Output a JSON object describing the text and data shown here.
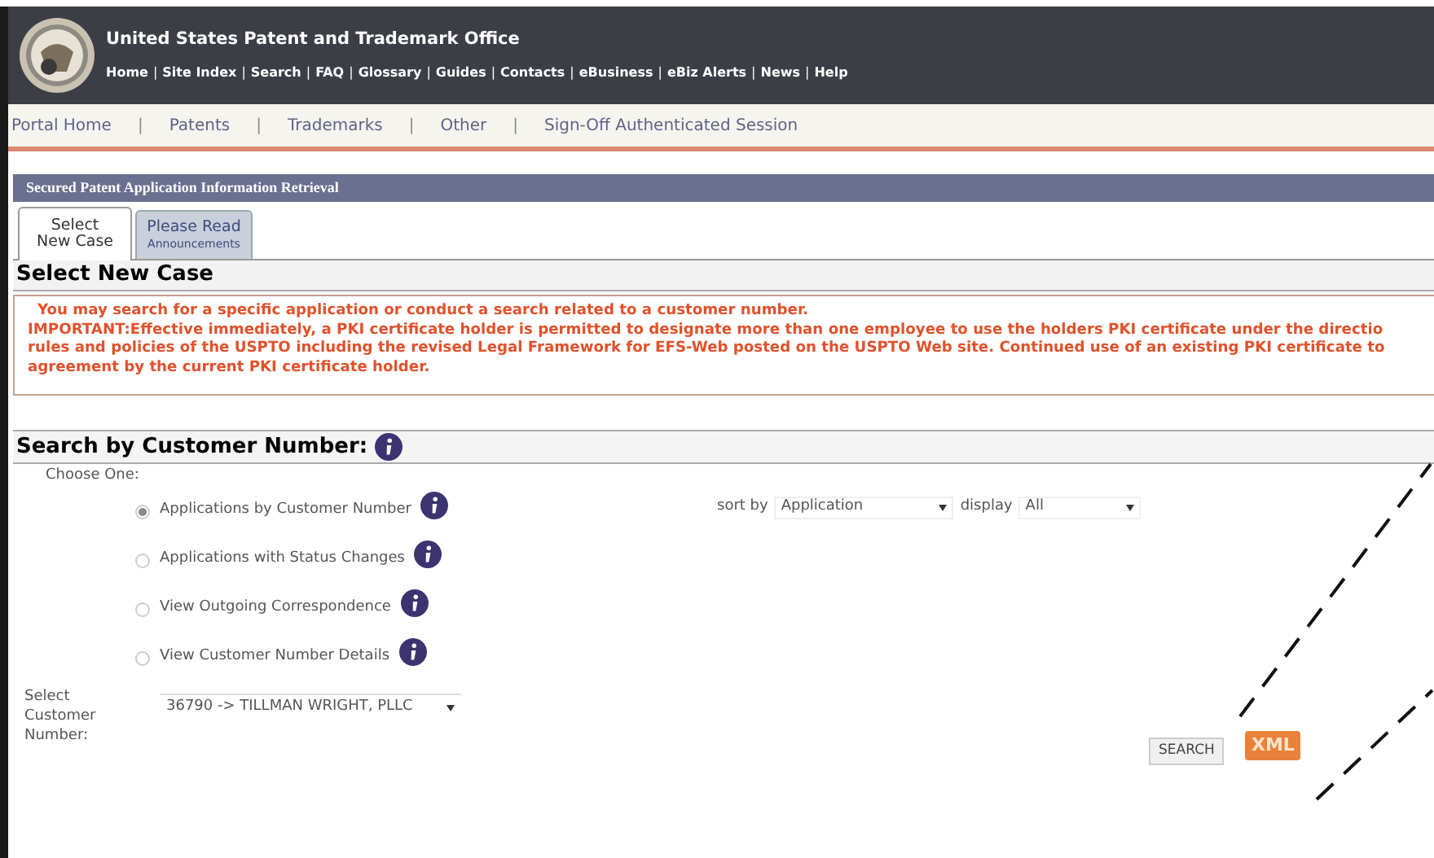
{
  "header": {
    "title": "United States Patent and Trademark Office",
    "links": [
      {
        "kind": "link",
        "text": "Home"
      },
      {
        "kind": "sep",
        "text": "|"
      },
      {
        "kind": "link",
        "text": "Site Index"
      },
      {
        "kind": "sep",
        "text": "|"
      },
      {
        "kind": "link",
        "text": "Search"
      },
      {
        "kind": "sep",
        "text": "|"
      },
      {
        "kind": "link",
        "text": "FAQ"
      },
      {
        "kind": "sep",
        "text": "|"
      },
      {
        "kind": "link",
        "text": "Glossary"
      },
      {
        "kind": "sep",
        "text": "|"
      },
      {
        "kind": "link",
        "text": "Guides"
      },
      {
        "kind": "sep",
        "text": "|"
      },
      {
        "kind": "link",
        "text": "Contacts"
      },
      {
        "kind": "sep",
        "text": "|"
      },
      {
        "kind": "link",
        "text": "eBusiness"
      },
      {
        "kind": "sep",
        "text": "|"
      },
      {
        "kind": "link",
        "text": "eBiz Alerts"
      },
      {
        "kind": "sep",
        "text": "|"
      },
      {
        "kind": "link",
        "text": "News"
      },
      {
        "kind": "sep",
        "text": "|"
      },
      {
        "kind": "link",
        "text": "Help"
      }
    ]
  },
  "nav": [
    {
      "kind": "link",
      "text": "Portal Home"
    },
    {
      "kind": "sep",
      "text": "|"
    },
    {
      "kind": "link",
      "text": "Patents"
    },
    {
      "kind": "sep",
      "text": "|"
    },
    {
      "kind": "link",
      "text": "Trademarks"
    },
    {
      "kind": "sep",
      "text": "|"
    },
    {
      "kind": "link",
      "text": "Other"
    },
    {
      "kind": "sep",
      "text": "|"
    },
    {
      "kind": "link",
      "text": "Sign-Off Authenticated Session"
    }
  ],
  "panel_title": "Secured Patent Application Information Retrieval",
  "tabs": [
    {
      "lines": [
        "Select",
        "New Case"
      ],
      "selected": true
    },
    {
      "lines": [
        "Please Read",
        "Announcements"
      ],
      "selected": false
    }
  ],
  "section_title": "Select New Case",
  "notice": {
    "intro": "You may search for a specific application or conduct a search related to a customer number.",
    "lines": [
      "IMPORTANT:Effective immediately, a PKI certificate holder is permitted to designate more than one employee to use the holders PKI certificate under the directio",
      "rules and policies of the USPTO including the revised Legal Framework for EFS-Web posted on the USPTO Web site. Continued use of an existing PKI certificate to",
      "agreement by the current PKI certificate holder."
    ]
  },
  "search": {
    "title": "Search by Customer Number:",
    "choose_label": "Choose One:",
    "options": [
      {
        "label": "Applications by Customer Number",
        "selected": true
      },
      {
        "label": "Applications with Status Changes",
        "selected": false
      },
      {
        "label": "View Outgoing Correspondence",
        "selected": false
      },
      {
        "label": "View Customer Number Details",
        "selected": false
      }
    ],
    "sort_label": "sort by",
    "sort_value": "Application",
    "display_label": "display",
    "display_value": "All",
    "customer_label": "Select Customer Number:",
    "customer_value": "36790 -> TILLMAN WRIGHT, PLLC",
    "search_button": "SEARCH",
    "xml_button": "XML"
  }
}
